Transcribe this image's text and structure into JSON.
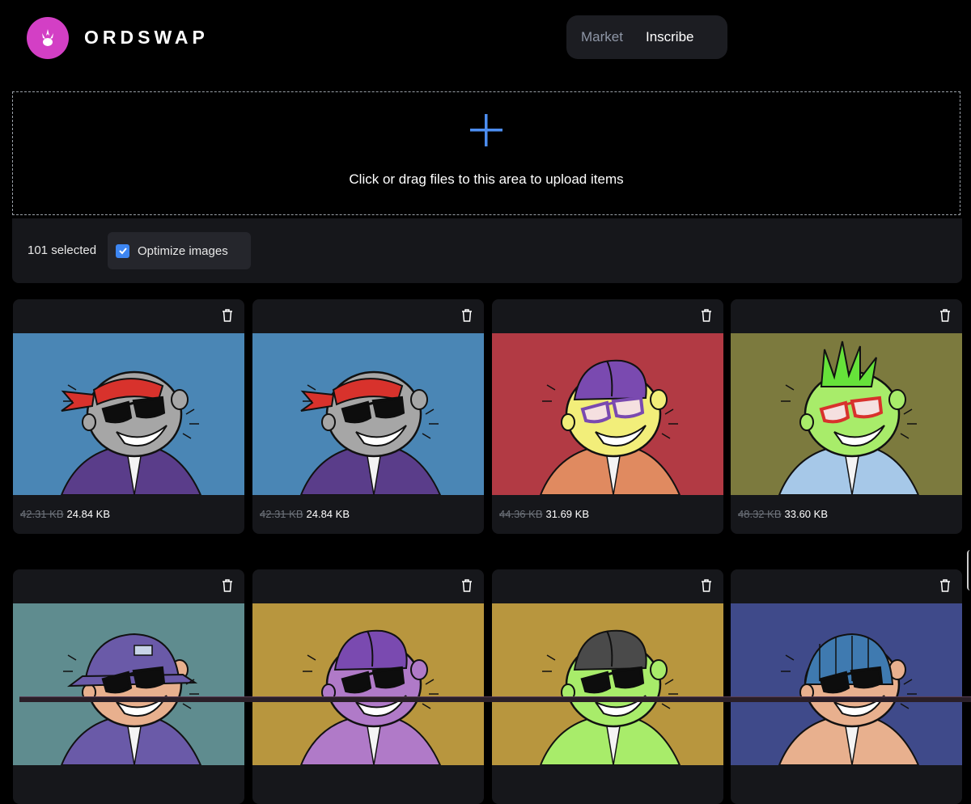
{
  "brand": {
    "name": "ORDSWAP",
    "logo_color": "#d33fc5"
  },
  "nav": {
    "tabs": [
      {
        "label": "Market",
        "active": false
      },
      {
        "label": "Inscribe",
        "active": true
      }
    ]
  },
  "upload": {
    "text": "Click or drag files to this area to upload items",
    "icon": "plus-icon",
    "icon_color": "#4c8df0"
  },
  "toolbar": {
    "selected_text": "101 selected",
    "optimize_label": "Optimize images",
    "optimize_checked": true
  },
  "items": [
    {
      "old_size": "42.31 KB",
      "new_size": "24.84 KB",
      "bg": "#4a86b5",
      "face": "#a6a6a6",
      "hat": "red-bandana",
      "hat_color": "#d8322c",
      "jacket": "#5a3d8a",
      "glasses": "black"
    },
    {
      "old_size": "42.31 KB",
      "new_size": "24.84 KB",
      "bg": "#4a86b5",
      "face": "#a6a6a6",
      "hat": "red-bandana",
      "hat_color": "#d8322c",
      "jacket": "#5a3d8a",
      "glasses": "black"
    },
    {
      "old_size": "44.36 KB",
      "new_size": "31.69 KB",
      "bg": "#b23a44",
      "face": "#f2ee7a",
      "hat": "cap",
      "hat_color": "#7a4ab0",
      "jacket": "#e08a60",
      "glasses": "purple"
    },
    {
      "old_size": "48.32 KB",
      "new_size": "33.60 KB",
      "bg": "#7c7a3e",
      "face": "#a8ec6a",
      "hat": "spikes",
      "hat_color": "#66e23a",
      "jacket": "#a6c8e8",
      "glasses": "red"
    },
    {
      "bg": "#5f8c8f",
      "face": "#e8b08e",
      "hat": "bucket",
      "hat_color": "#6a5aa8",
      "jacket": "#6a5aa8",
      "glasses": "black"
    },
    {
      "bg": "#b8963e",
      "face": "#b07ac8",
      "hat": "cap",
      "hat_color": "#7a4ab0",
      "jacket": "#b07ac8",
      "glasses": "black"
    },
    {
      "bg": "#b8963e",
      "face": "#a8ec6a",
      "hat": "cap",
      "hat_color": "#4a4a4a",
      "jacket": "#a8ec6a",
      "glasses": "black"
    },
    {
      "bg": "#3f4a8a",
      "face": "#e8b08e",
      "hat": "beanie",
      "hat_color": "#3f7ab0",
      "jacket": "#e8b08e",
      "glasses": "black"
    }
  ]
}
